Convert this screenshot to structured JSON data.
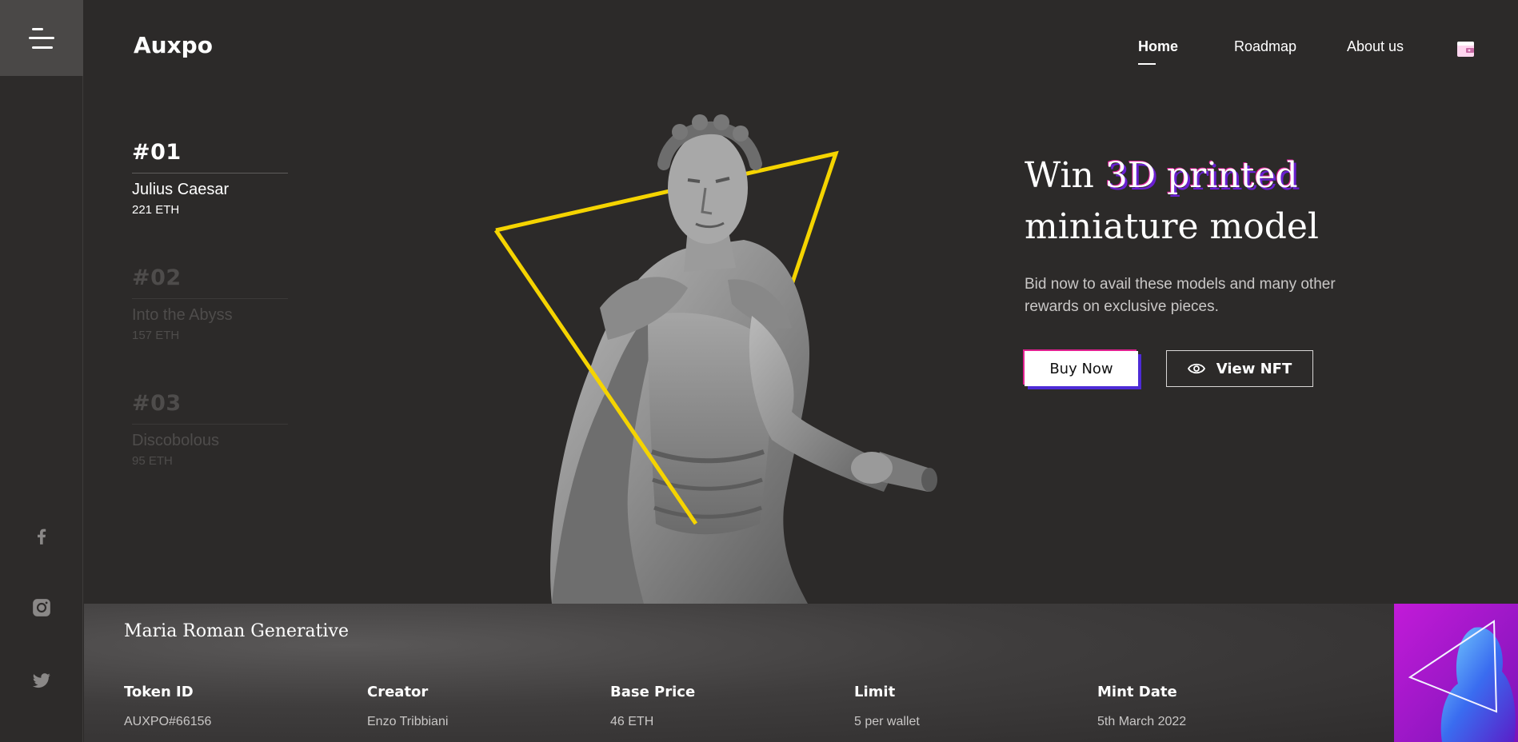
{
  "app": {
    "logo": "Auxpo"
  },
  "nav": {
    "items": [
      {
        "label": "Home",
        "active": true
      },
      {
        "label": "Roadmap",
        "active": false
      },
      {
        "label": "About us",
        "active": false
      }
    ],
    "wallet_icon": "wallet-icon"
  },
  "sidebar": {
    "menu_icon": "hamburger-menu-icon",
    "social": [
      "facebook-icon",
      "instagram-icon",
      "twitter-icon"
    ]
  },
  "collection": [
    {
      "number": "#01",
      "name": "Julius Caesar",
      "price": "221 ETH",
      "active": true
    },
    {
      "number": "#02",
      "name": "Into the Abyss",
      "price": "157 ETH",
      "active": false
    },
    {
      "number": "#03",
      "name": "Discobolous",
      "price": "95 ETH",
      "active": false
    }
  ],
  "hero": {
    "title_prefix": "Win ",
    "title_accent": "3D printed",
    "title_suffix": "miniature model",
    "description": "Bid now to avail these models and many other rewards on exclusive pieces.",
    "buy_label": "Buy Now",
    "view_label": "View NFT",
    "view_icon": "eye-icon"
  },
  "details": {
    "title": "Maria Roman Generative",
    "stats": [
      {
        "label": "Token ID",
        "value": "AUXPO#66156"
      },
      {
        "label": "Creator",
        "value": "Enzo Tribbiani"
      },
      {
        "label": "Base Price",
        "value": "46 ETH"
      },
      {
        "label": "Limit",
        "value": "5 per wallet"
      },
      {
        "label": "Mint Date",
        "value": "5th March 2022"
      }
    ]
  },
  "colors": {
    "background": "#2c2a29",
    "accent_yellow": "#f5d400",
    "accent_pink": "#e0208f",
    "accent_purple": "#4d2bd6"
  }
}
